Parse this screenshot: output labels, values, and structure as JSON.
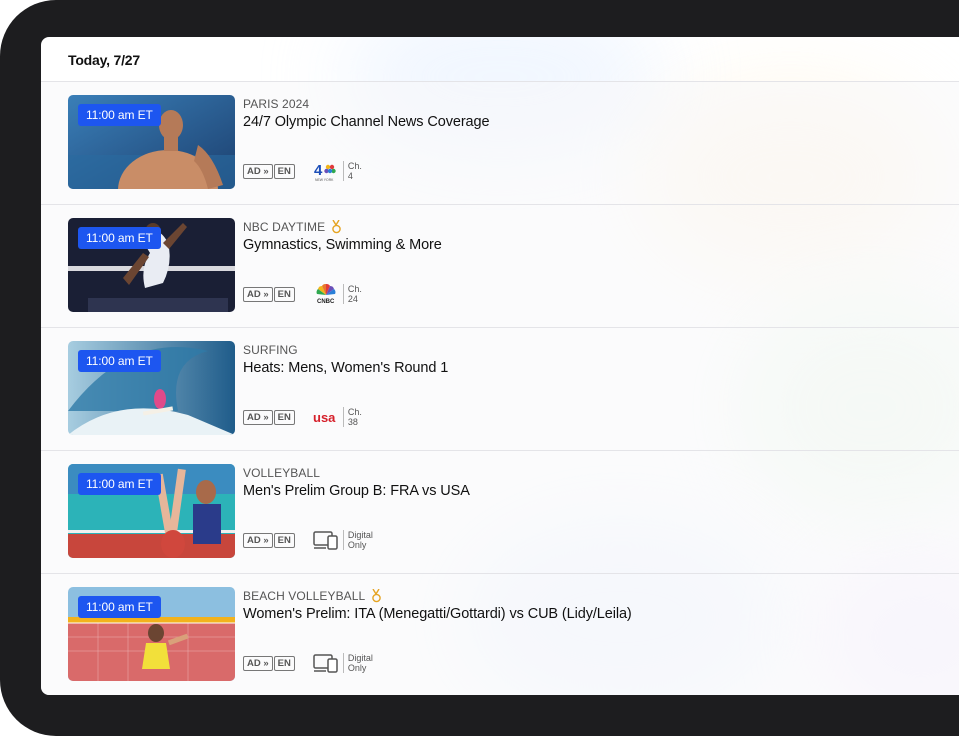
{
  "header": {
    "date": "Today, 7/27"
  },
  "rows": [
    {
      "time": "11:00 am ET",
      "category": "PARIS 2024",
      "medal": false,
      "title": "24/7 Olympic Channel News Coverage",
      "tags": [
        "AD »",
        "EN"
      ],
      "network": "nbc-new-york",
      "network_logo_text": "4",
      "network_logo_subtext": "NEW YORK",
      "channel_line1": "Ch.",
      "channel_line2": "4"
    },
    {
      "time": "11:00 am ET",
      "category": "NBC DAYTIME",
      "medal": true,
      "title": "Gymnastics, Swimming & More",
      "tags": [
        "AD »",
        "EN"
      ],
      "network": "cnbc",
      "network_logo_text": "CNBC",
      "channel_line1": "Ch.",
      "channel_line2": "24"
    },
    {
      "time": "11:00 am ET",
      "category": "SURFING",
      "medal": false,
      "title": "Heats: Mens, Women's Round 1",
      "tags": [
        "AD »",
        "EN"
      ],
      "network": "usa",
      "network_logo_text": "usa",
      "channel_line1": "Ch.",
      "channel_line2": "38"
    },
    {
      "time": "11:00 am ET",
      "category": "VOLLEYBALL",
      "medal": false,
      "title": "Men's Prelim Group B: FRA vs USA",
      "tags": [
        "AD »",
        "EN"
      ],
      "network": "digital",
      "channel_line1": "Digital",
      "channel_line2": "Only"
    },
    {
      "time": "11:00 am ET",
      "category": "BEACH VOLLEYBALL",
      "medal": true,
      "title": "Women's Prelim: ITA (Menegatti/Gottardi) vs CUB (Lidy/Leila)",
      "tags": [
        "AD »",
        "EN"
      ],
      "network": "digital",
      "channel_line1": "Digital",
      "channel_line2": "Only"
    }
  ],
  "colors": {
    "time_badge": "#1d56f0",
    "medal": "#e5a422",
    "usa_red": "#d6202b"
  }
}
